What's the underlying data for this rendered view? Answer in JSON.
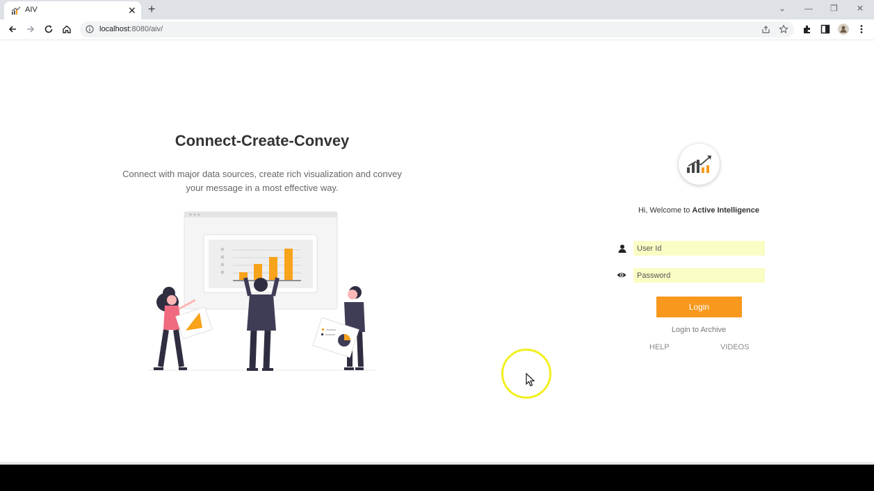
{
  "browser": {
    "tab_title": "AIV",
    "tab_close": "✕",
    "new_tab": "+",
    "url_host": "localhost",
    "url_path": ":8080/aiv/",
    "window_controls": [
      "⌄",
      "—",
      "❐",
      "✕"
    ]
  },
  "hero": {
    "title": "Connect-Create-Convey",
    "description": "Connect with major data sources, create rich visualization and convey your message in a most effective way."
  },
  "login": {
    "welcome_prefix": "Hi, Welcome to ",
    "welcome_brand": "Active Intelligence",
    "userid_placeholder": "User Id",
    "password_placeholder": "Password",
    "login_label": "Login",
    "archive_link": "Login to Archive",
    "help_link": "HELP",
    "videos_link": "VIDEOS"
  },
  "colors": {
    "accent": "#f8981d",
    "input_bg": "#fafdc4",
    "cursor_highlight": "#f2ef1e"
  },
  "icons": {
    "user_field": "user-icon",
    "password_field": "eye-icon"
  }
}
